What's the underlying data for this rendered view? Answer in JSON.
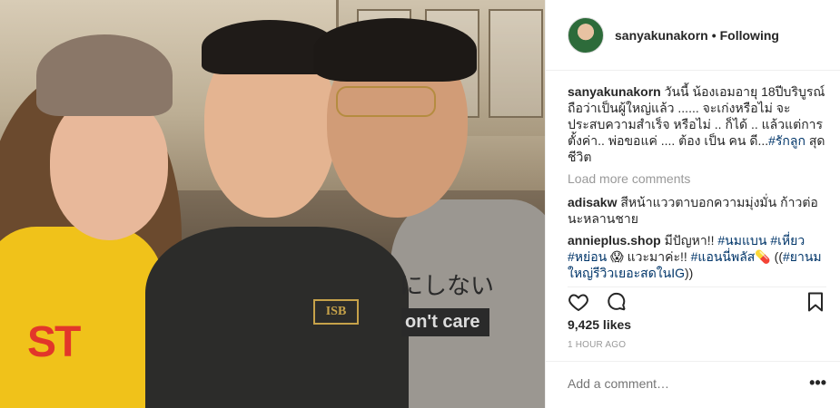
{
  "post": {
    "username": "sanyakunakorn",
    "separator": "•",
    "follow_state": "Following"
  },
  "photo": {
    "shirt_logo": "ISB",
    "shirt_text_jp": "にしない",
    "shirt_text_en": "on't care",
    "yellow_shirt_text": "ST"
  },
  "caption": {
    "user": "sanyakunakorn",
    "text": "วันนี้ น้องเอมอายุ 18ปีบริบูรณ์ ถือว่าเป็นผู้ใหญ่แล้ว ...... จะเก่งหรือไม่ จะประสบความสำเร็จ หรือไม่ .. ก็ได้ .. แล้วแต่การตั้งค่า.. พ่อขอแค่ .... ต้อง เป็น คน ดี...",
    "tag": "#รักลูก",
    "tail": " สุดชีวิต"
  },
  "load_more": "Load more comments",
  "comments": [
    {
      "user": "adisakw",
      "text": "สีหน้าแววตาบอกความมุ่งมั่น ก้าวต่อนะหลานชาย"
    },
    {
      "user": "annieplus.shop",
      "text_a": "มีปัญหา!! ",
      "tag_a": "#นมแบน #เหี่ยว #หย่อน",
      "emoji_a": " 😱 ",
      "text_b": "แวะมาค่ะ!! ",
      "tag_b": "#แอนนี่พลัส",
      "emoji_b": "💊",
      "text_c": " ((",
      "tag_c": "#ยานมใหญ่รีวิวเยอะสดในIG",
      "text_d": "))"
    }
  ],
  "likes": "9,425 likes",
  "time": "1 HOUR AGO",
  "comment_box": {
    "placeholder": "Add a comment…",
    "more": "•••"
  },
  "icons": [
    "heart-icon",
    "comment-icon",
    "bookmark-icon",
    "more-icon"
  ]
}
